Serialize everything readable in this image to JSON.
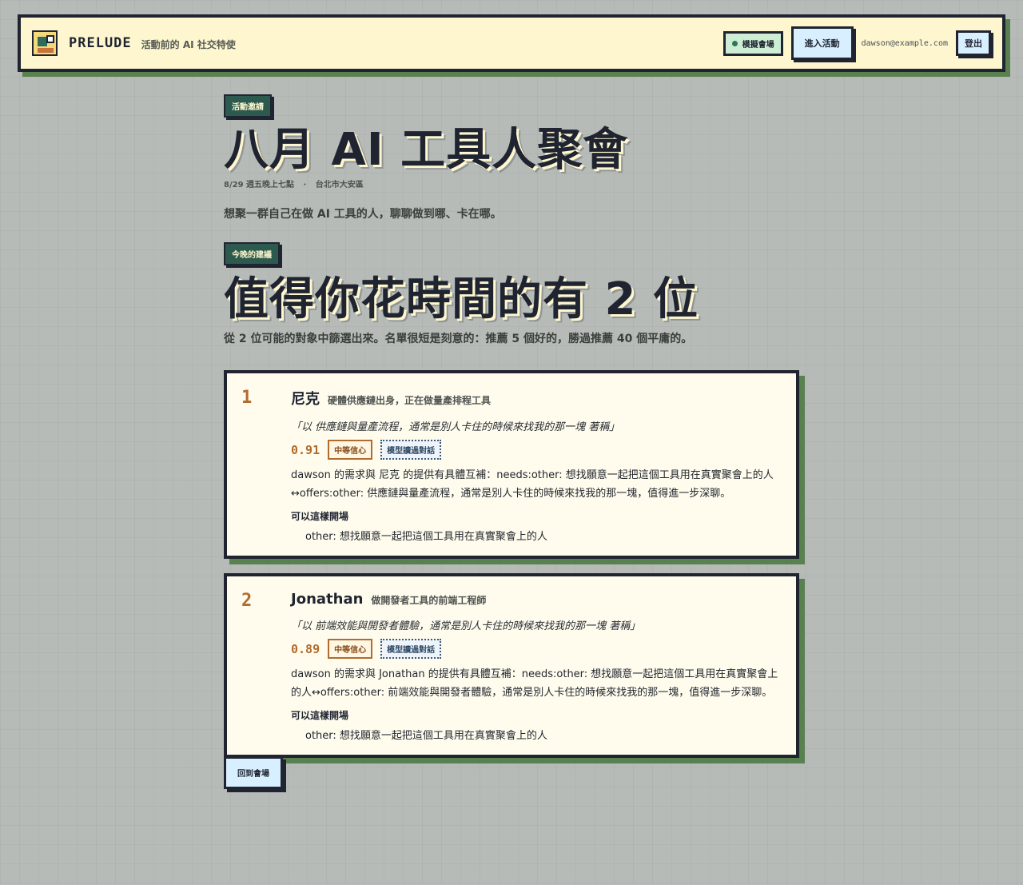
{
  "header": {
    "brand": "PRELUDE",
    "tagline": "活動前的 AI 社交特使",
    "mode_label": "模擬會場",
    "enter_label": "進入活動",
    "email": "dawson@example.com",
    "logout_label": "登出"
  },
  "event": {
    "tag": "活動邀請",
    "title": "八月 AI 工具人聚會",
    "date": "8/29",
    "time": "週五晚上七點",
    "separator": "·",
    "location": "台北市大安區",
    "description": "想聚一群自己在做 AI 工具的人，聊聊做到哪、卡在哪。"
  },
  "suggestions": {
    "tag": "今晚的建議",
    "title": "值得你花時間的有 2 位",
    "subtitle": "從 2 位可能的對象中篩選出來。名單很短是刻意的：推薦 5 個好的，勝過推薦 40 個平庸的。",
    "items": [
      {
        "rank": "1",
        "name": "尼克",
        "role": "硬體供應鏈出身，正在做量產排程工具",
        "quote": "「以 供應鏈與量產流程，通常是別人卡住的時候來找我的那一塊 著稱」",
        "score": "0.91",
        "confidence": "中等信心",
        "model_badge": "模型讀過對話",
        "reason": "dawson 的需求與 尼克 的提供有具體互補：needs:other: 想找願意一起把這個工具用在真實聚會上的人↔offers:other: 供應鏈與量產流程，通常是別人卡住的時候來找我的那一塊，值得進一步深聊。",
        "opener_title": "可以這樣開場",
        "opener": "other: 想找願意一起把這個工具用在真實聚會上的人"
      },
      {
        "rank": "2",
        "name": "Jonathan",
        "role": "做開發者工具的前端工程師",
        "quote": "「以 前端效能與開發者體驗，通常是別人卡住的時候來找我的那一塊 著稱」",
        "score": "0.89",
        "confidence": "中等信心",
        "model_badge": "模型讀過對話",
        "reason": "dawson 的需求與 Jonathan 的提供有具體互補：needs:other: 想找願意一起把這個工具用在真實聚會上的人↔offers:other: 前端效能與開發者體驗，通常是別人卡住的時候來找我的那一塊，值得進一步深聊。",
        "opener_title": "可以這樣開場",
        "opener": "other: 想找願意一起把這個工具用在真實聚會上的人"
      }
    ]
  },
  "footer": {
    "back_label": "回到會場"
  },
  "colors": {
    "background": "#b6bbb8",
    "header_bg": "#fdf6cf",
    "ink": "#1f2430",
    "shadow_green": "#59804f",
    "tag_green": "#2d5a4f",
    "accent_orange": "#b26b2e",
    "button_blue": "#d8efff"
  }
}
